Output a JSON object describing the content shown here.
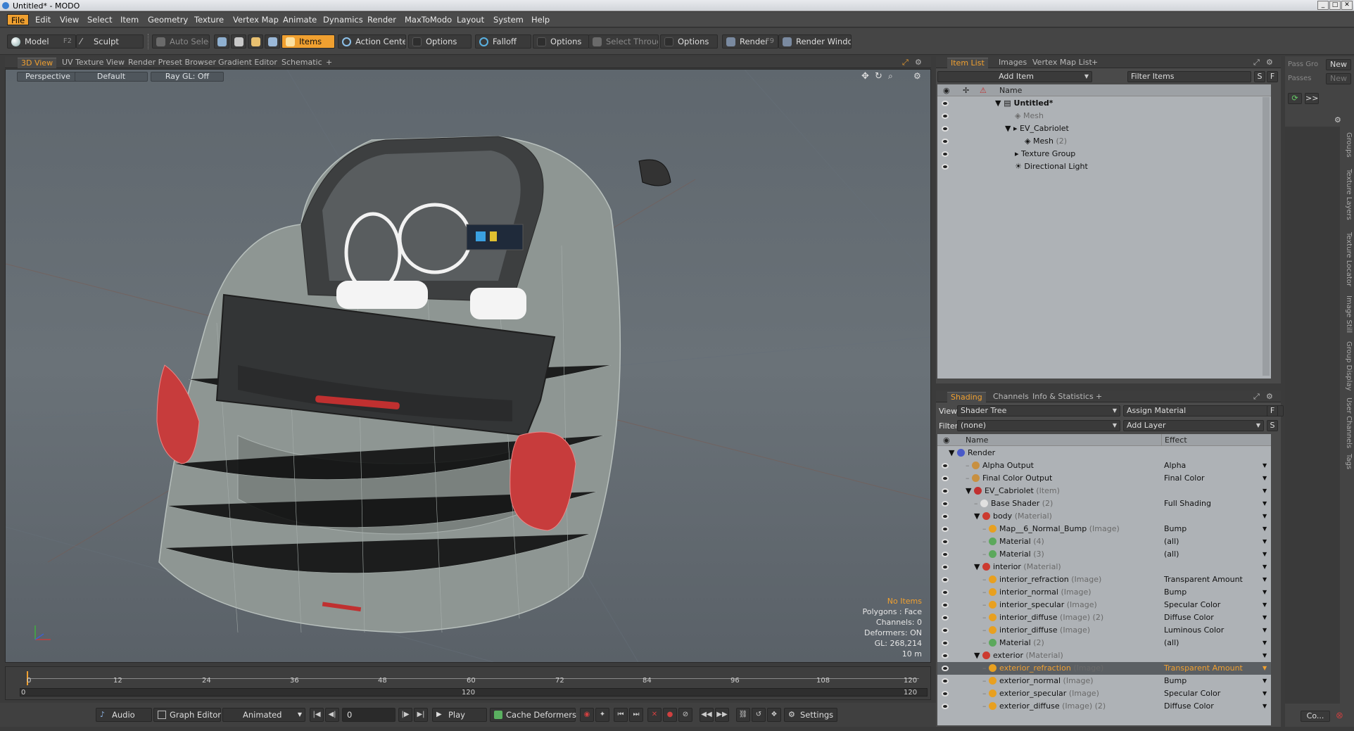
{
  "window": {
    "title": "Untitled* - MODO"
  },
  "menu": [
    "File",
    "Edit",
    "View",
    "Select",
    "Item",
    "Geometry",
    "Texture",
    "Vertex Map",
    "Animate",
    "Dynamics",
    "Render",
    "MaxToModo",
    "Layout",
    "System",
    "Help"
  ],
  "toolbar": {
    "model": "Model",
    "model_key": "F2",
    "sculpt": "Sculpt",
    "auto_select": "Auto Select",
    "items": "Items",
    "action_center": "Action Center",
    "options1": "Options",
    "falloff": "Falloff",
    "options2": "Options",
    "select_through": "Select Through",
    "options3": "Options",
    "render": "Render",
    "render_key": "F9",
    "render_window": "Render Window"
  },
  "viewport_tabs": [
    "3D View",
    "UV Texture View",
    "Render Preset Browser",
    "Gradient Editor",
    "Schematic",
    "+"
  ],
  "viewport": {
    "projection": "Perspective",
    "shading": "Default",
    "raygl": "Ray GL: Off",
    "stats": {
      "items": "No Items",
      "polygons": "Polygons : Face",
      "channels": "Channels: 0",
      "deformers": "Deformers: ON",
      "gl": "GL: 268,214",
      "scale": "10 m"
    }
  },
  "timeline": {
    "ticks": [
      "0",
      "12",
      "24",
      "36",
      "48",
      "60",
      "72",
      "84",
      "96",
      "108",
      "120"
    ],
    "start": "0",
    "end": "120",
    "end_right": "120"
  },
  "bottombar": {
    "audio": "Audio",
    "graph_editor": "Graph Editor",
    "animated": "Animated",
    "frame": "0",
    "play": "Play",
    "cache": "Cache Deformers",
    "settings": "Settings"
  },
  "itemlist": {
    "tabs": [
      "Item List",
      "Images",
      "Vertex Map List",
      "+"
    ],
    "add_item": "Add Item",
    "filter": "Filter Items",
    "s": "S",
    "f": "F",
    "col_name": "Name",
    "rows": [
      {
        "label": "Untitled*",
        "count": ""
      },
      {
        "label": "Mesh",
        "count": ""
      },
      {
        "label": "EV_Cabriolet",
        "count": ""
      },
      {
        "label": "Mesh",
        "count": "(2)"
      },
      {
        "label": "Texture Group",
        "count": ""
      },
      {
        "label": "Directional Light",
        "count": ""
      }
    ]
  },
  "farright": {
    "pass_group": "Pass Gro",
    "new1": "New",
    "passes": "Passes",
    "new2": "New",
    "arrow": ">>",
    "co": "Co...",
    "vtabs": [
      "Groups",
      "Texture Layers",
      "Texture Locator",
      "Image Still",
      "Group Display",
      "User Channels",
      "Tags"
    ]
  },
  "shading": {
    "tabs": [
      "Shading",
      "Channels",
      "Info & Statistics",
      "+"
    ],
    "view_label": "View",
    "view_value": "Shader Tree",
    "assign": "Assign Material",
    "f": "F",
    "filter_label": "Filter",
    "filter_value": "(none)",
    "add_layer": "Add Layer",
    "s": "S",
    "col_name": "Name",
    "col_effect": "Effect",
    "rows": [
      {
        "name": "Render",
        "tag": "",
        "effect": ""
      },
      {
        "name": "Alpha Output",
        "tag": "",
        "effect": "Alpha"
      },
      {
        "name": "Final Color Output",
        "tag": "",
        "effect": "Final Color"
      },
      {
        "name": "EV_Cabriolet",
        "tag": "(Item)",
        "effect": ""
      },
      {
        "name": "Base Shader",
        "tag": "(2)",
        "effect": "Full Shading"
      },
      {
        "name": "body",
        "tag": "(Material)",
        "effect": ""
      },
      {
        "name": "Map__6_Normal_Bump",
        "tag": "(Image)",
        "effect": "Bump"
      },
      {
        "name": "Material",
        "tag": "(4)",
        "effect": "(all)"
      },
      {
        "name": "Material",
        "tag": "(3)",
        "effect": "(all)"
      },
      {
        "name": "interior",
        "tag": "(Material)",
        "effect": ""
      },
      {
        "name": "interior_refraction",
        "tag": "(Image)",
        "effect": "Transparent Amount"
      },
      {
        "name": "interior_normal",
        "tag": "(Image)",
        "effect": "Bump"
      },
      {
        "name": "interior_specular",
        "tag": "(Image)",
        "effect": "Specular Color"
      },
      {
        "name": "interior_diffuse",
        "tag": "(Image) (2)",
        "effect": "Diffuse Color"
      },
      {
        "name": "interior_diffuse",
        "tag": "(Image)",
        "effect": "Luminous Color"
      },
      {
        "name": "Material",
        "tag": "(2)",
        "effect": "(all)"
      },
      {
        "name": "exterior",
        "tag": "(Material)",
        "effect": ""
      },
      {
        "name": "exterior_refraction",
        "tag": "(Image)",
        "effect": "Transparent Amount"
      },
      {
        "name": "exterior_normal",
        "tag": "(Image)",
        "effect": "Bump"
      },
      {
        "name": "exterior_specular",
        "tag": "(Image)",
        "effect": "Specular Color"
      },
      {
        "name": "exterior_diffuse",
        "tag": "(Image) (2)",
        "effect": "Diffuse Color"
      }
    ]
  },
  "colors": {
    "accent": "#f0a030",
    "material": "#cc3a30",
    "image": "#e8a020",
    "submat": "#5ca85c"
  }
}
